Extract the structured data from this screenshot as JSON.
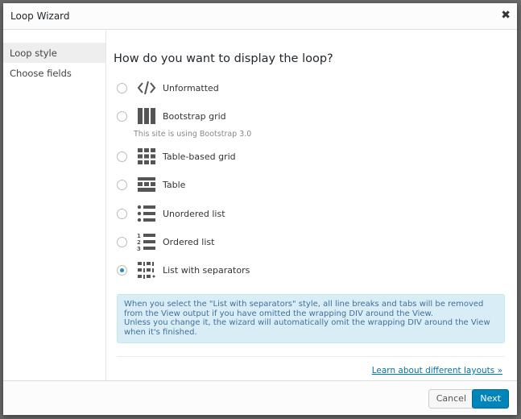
{
  "dialog": {
    "title": "Loop Wizard",
    "close_icon": "close-icon"
  },
  "sidebar": {
    "items": [
      {
        "label": "Loop style",
        "active": true
      },
      {
        "label": "Choose fields",
        "active": false
      }
    ]
  },
  "main": {
    "question": "How do you want to display the loop?",
    "options": [
      {
        "label": "Unformatted",
        "icon": "code-icon",
        "selected": false
      },
      {
        "label": "Bootstrap grid",
        "icon": "columns-icon",
        "selected": false,
        "note": "This site is using Bootstrap 3.0"
      },
      {
        "label": "Table-based grid",
        "icon": "grid-icon",
        "selected": false
      },
      {
        "label": "Table",
        "icon": "table-icon",
        "selected": false
      },
      {
        "label": "Unordered list",
        "icon": "unordered-list-icon",
        "selected": false
      },
      {
        "label": "Ordered list",
        "icon": "ordered-list-icon",
        "selected": false
      },
      {
        "label": "List with separators",
        "icon": "separator-list-icon",
        "selected": true
      }
    ],
    "info_lines": [
      "When you select the \"List with separators\" style, all line breaks and tabs will be removed from the View output if you have omitted the wrapping DIV around the View.",
      "Unless you change it, the wizard will automatically omit the wrapping DIV around the View when it's finished."
    ],
    "learn_link": "Learn about different layouts »"
  },
  "footer": {
    "cancel": "Cancel",
    "next": "Next"
  },
  "colors": {
    "primary": "#0085ba",
    "info_bg": "#d9edf7",
    "link": "#0073aa"
  }
}
